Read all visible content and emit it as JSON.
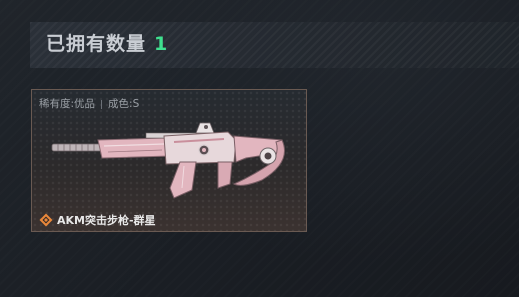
{
  "inventory": {
    "owned_label": "已拥有数量",
    "owned_count": "1"
  },
  "item": {
    "rarity_label": "稀有度:优品",
    "condition_label": "成色:S",
    "name": "AKM突击步枪-群星",
    "rarity_icon": "diamond-rarity-icon",
    "rarity_color": "#e8873a",
    "skin_color": "#e2b6bf"
  },
  "colors": {
    "accent_count": "#3fe08f",
    "card_border": "#6a5a52"
  }
}
